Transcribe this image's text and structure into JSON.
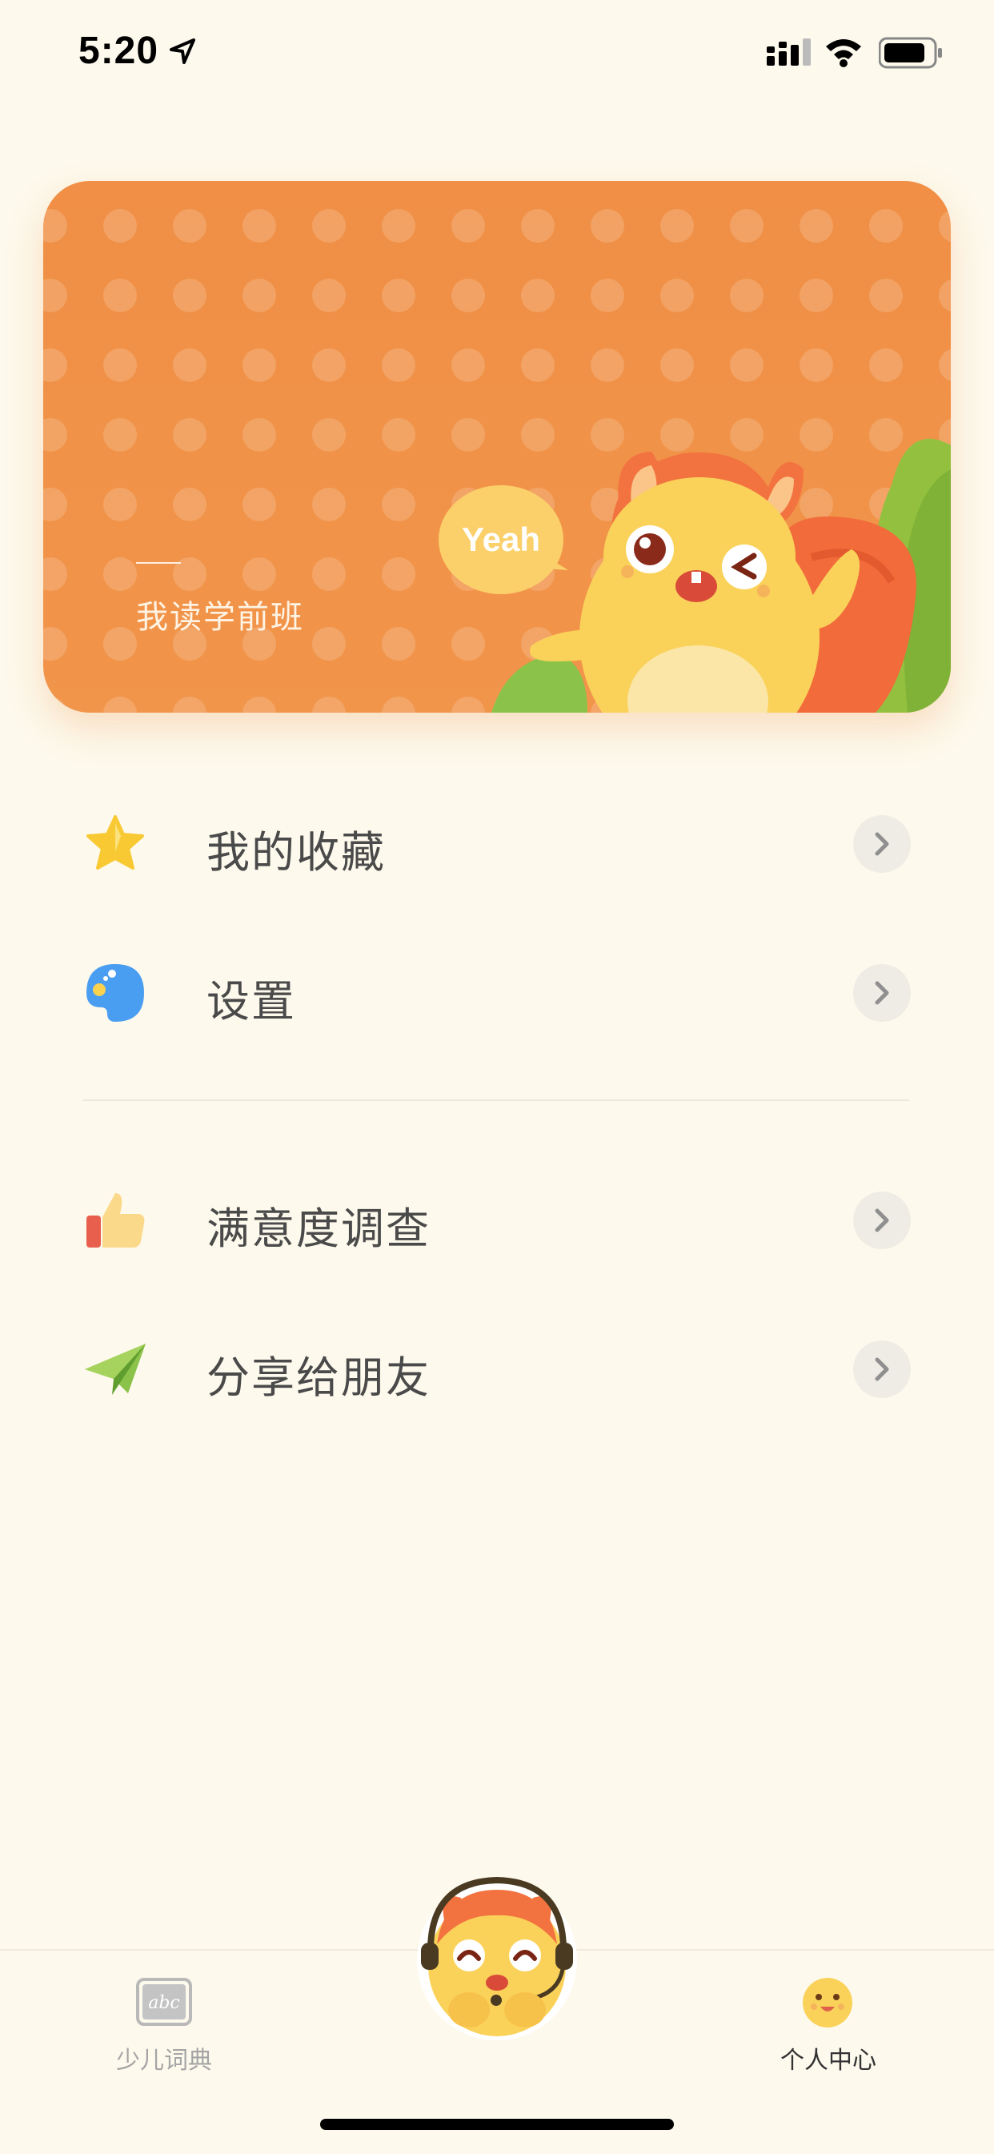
{
  "status_bar": {
    "time": "5:20"
  },
  "hero": {
    "title": "我读学前班",
    "bubble_text": "Yeah"
  },
  "menu": [
    {
      "label": "我的收藏",
      "icon": "star-icon"
    },
    {
      "label": "设置",
      "icon": "palette-icon"
    },
    {
      "label": "满意度调查",
      "icon": "thumbs-up-icon"
    },
    {
      "label": "分享给朋友",
      "icon": "paper-plane-icon"
    }
  ],
  "tab_bar": {
    "tabs": [
      {
        "label": "少儿词典",
        "icon": "dictionary-icon",
        "active": false
      },
      {
        "label": "个人中心",
        "icon": "smiley-face-icon",
        "active": true
      }
    ],
    "center_button": {
      "icon": "squirrel-headset-mascot"
    },
    "dict_icon_text": "abc"
  },
  "colors": {
    "background": "#fdf9ec",
    "hero_orange": "#f08f45",
    "accent_green": "#8bc34a"
  }
}
